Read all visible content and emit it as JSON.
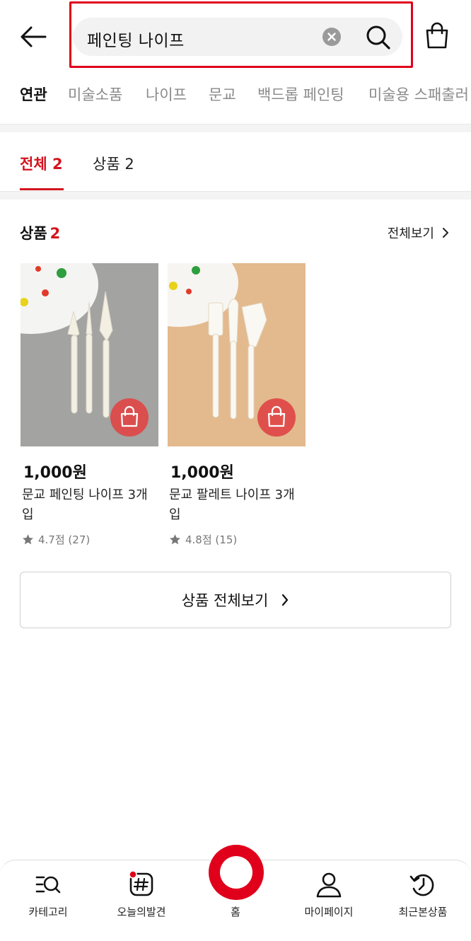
{
  "header": {
    "search_value": "페인팅 나이프",
    "back_icon": "arrow-left-icon",
    "clear_icon": "clear-circle-icon",
    "search_icon": "search-icon",
    "cart_icon": "shopping-bag-icon",
    "highlight_color": "#e0001b"
  },
  "keywords": {
    "label": "연관",
    "items": [
      "미술소품",
      "나이프",
      "문교",
      "백드롭 페인팅",
      "미술용 스패출러"
    ]
  },
  "tabs": [
    {
      "label": "전체 2",
      "active": true
    },
    {
      "label": "상품 2",
      "active": false
    }
  ],
  "section": {
    "title": "상품",
    "count": "2",
    "view_all": "전체보기"
  },
  "products": [
    {
      "price": "1,000원",
      "name": "문교 페인팅 나이프 3개입",
      "rating": "4.7점 (27)",
      "bag_icon": "shopping-bag-icon"
    },
    {
      "price": "1,000원",
      "name": "문교 팔레트 나이프 3개입",
      "rating": "4.8점 (15)",
      "bag_icon": "shopping-bag-icon"
    }
  ],
  "all_products_button": "상품 전체보기",
  "bottom_nav": {
    "items": [
      {
        "label": "카테고리",
        "icon": "category-search-icon"
      },
      {
        "label": "오늘의발견",
        "icon": "hashtag-icon"
      },
      {
        "label": "홈",
        "icon": "home-circle-icon"
      },
      {
        "label": "마이페이지",
        "icon": "user-icon"
      },
      {
        "label": "최근본상품",
        "icon": "history-icon"
      }
    ]
  },
  "colors": {
    "accent": "#d3131d",
    "brand": "#e0001b",
    "muted_text": "#8a8a8a"
  }
}
